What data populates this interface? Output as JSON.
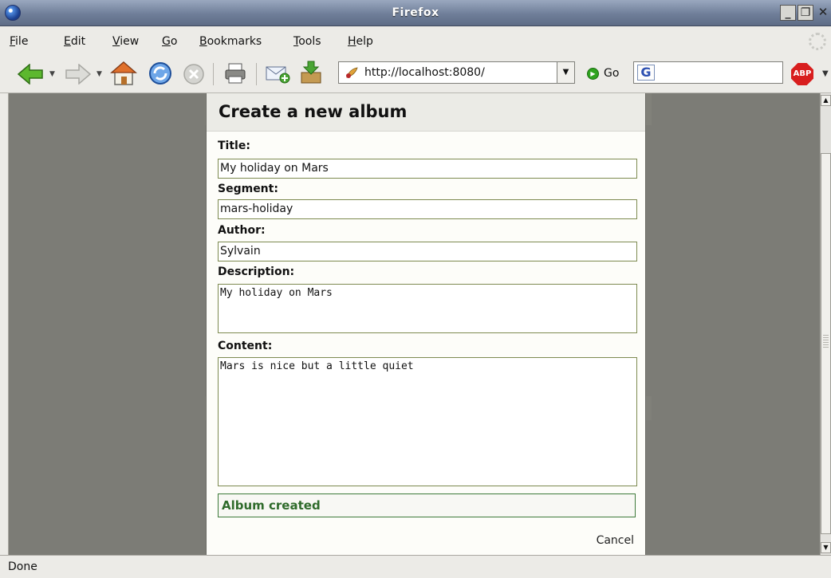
{
  "window": {
    "title": "Firefox",
    "controls": {
      "minimize": "_",
      "maximize": "❐",
      "close": "✕"
    }
  },
  "menu": {
    "items": [
      {
        "label": "File",
        "underline": "F",
        "rest": "ile"
      },
      {
        "label": "Edit",
        "underline": "E",
        "rest": "dit"
      },
      {
        "label": "View",
        "underline": "V",
        "rest": "iew"
      },
      {
        "label": "Go",
        "underline": "G",
        "rest": "o"
      },
      {
        "label": "Bookmarks",
        "underline": "B",
        "rest": "ookmarks"
      },
      {
        "label": "Tools",
        "underline": "T",
        "rest": "ools"
      },
      {
        "label": "Help",
        "underline": "H",
        "rest": "elp"
      }
    ]
  },
  "toolbar": {
    "url": "http://localhost:8080/",
    "go_label": "Go",
    "search_value": "",
    "search_engine_glyph": "G",
    "abp_label": "ABP",
    "icons": [
      "back-icon",
      "forward-icon",
      "home-icon",
      "reload-icon",
      "stop-icon",
      "print-icon",
      "new-mail-icon",
      "downloads-icon",
      "site-leaf-icon",
      "go-icon",
      "google-icon",
      "adblock-icon"
    ]
  },
  "dialog": {
    "heading": "Create a new album",
    "fields": {
      "title_label": "Title:",
      "title_value": "My holiday on Mars",
      "segment_label": "Segment:",
      "segment_value": "mars-holiday",
      "author_label": "Author:",
      "author_value": "Sylvain",
      "description_label": "Description:",
      "description_value": "My holiday on Mars",
      "content_label": "Content:",
      "content_value": "Mars is nice but a little quiet"
    },
    "status_message": "Album created",
    "cancel_label": "Cancel"
  },
  "statusbar": {
    "text": "Done"
  },
  "colors": {
    "page_background": "#7c7c76",
    "field_border": "#7d8a50",
    "success_text": "#2f6b2b",
    "titlebar": "#6f7e99"
  }
}
